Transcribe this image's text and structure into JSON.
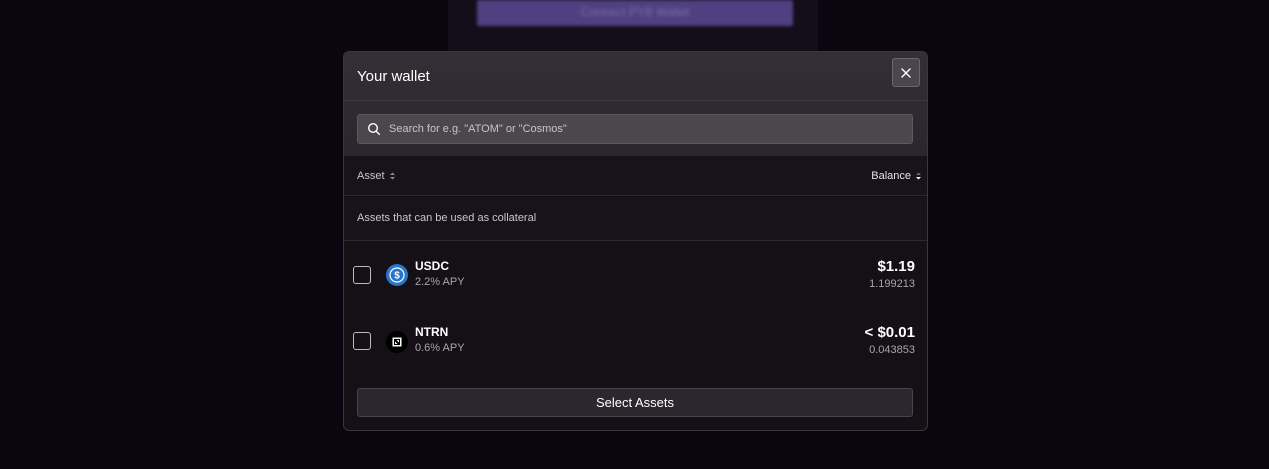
{
  "background": {
    "button_label": "Connect PYB Wallet"
  },
  "modal": {
    "title": "Your wallet",
    "close_icon": "close-icon",
    "search": {
      "placeholder": "Search for e.g. \"ATOM\" or \"Cosmos\"",
      "value": "",
      "icon": "search-icon"
    },
    "columns": {
      "asset": "Asset",
      "balance": "Balance"
    },
    "section_label": "Assets that can be used as collateral",
    "assets": [
      {
        "symbol": "USDC",
        "apy": "2.2% APY",
        "value": "$1.19",
        "amount": "1.199213",
        "checked": false,
        "icon": "usdc-icon",
        "icon_color": "#2775ca"
      },
      {
        "symbol": "NTRN",
        "apy": "0.6% APY",
        "value": "< $0.01",
        "amount": "0.043853",
        "checked": false,
        "icon": "ntrn-icon",
        "icon_color": "#000000"
      }
    ],
    "select_button": "Select Assets"
  },
  "colors": {
    "page_background": "#0b0510",
    "modal_background": "#141016",
    "accent_purple": "#5b4a93"
  }
}
